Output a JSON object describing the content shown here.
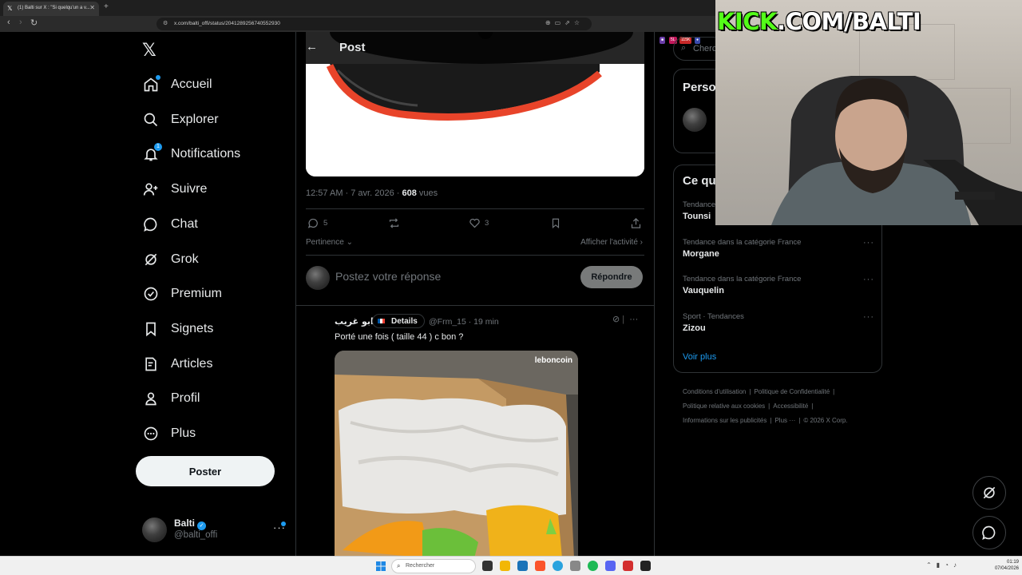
{
  "browser": {
    "tab_title": "(1) Balti sur X : \"Si quelqu'un a v...",
    "url": "x.com/balti_offi/status/2041289256740552930",
    "extensions": [
      "5L",
      "115K"
    ]
  },
  "nav": {
    "items": [
      {
        "label": "Accueil",
        "icon": "home-icon"
      },
      {
        "label": "Explorer",
        "icon": "search-icon"
      },
      {
        "label": "Notifications",
        "icon": "bell-icon",
        "badge": "1"
      },
      {
        "label": "Suivre",
        "icon": "add-person-icon"
      },
      {
        "label": "Chat",
        "icon": "chat-bubble-icon"
      },
      {
        "label": "Grok",
        "icon": "grok-icon"
      },
      {
        "label": "Premium",
        "icon": "verified-badge-icon"
      },
      {
        "label": "Signets",
        "icon": "bookmark-icon"
      },
      {
        "label": "Articles",
        "icon": "article-icon"
      },
      {
        "label": "Profil",
        "icon": "person-icon"
      },
      {
        "label": "Plus",
        "icon": "more-circle-icon"
      }
    ],
    "post_button": "Poster",
    "account": {
      "name": "Balti",
      "handle": "@balti_offi"
    }
  },
  "post": {
    "header_title": "Post",
    "time": "12:57 AM · 7 avr. 2026 · ",
    "views_count": "608",
    "views_label": " vues",
    "replies": "5",
    "likes": "3",
    "sort_label": "Pertinence",
    "activity_label": "Afficher l'activité",
    "reply_placeholder": "Postez votre réponse",
    "reply_button": "Répondre"
  },
  "reply": {
    "name": "ابو غريب",
    "badge": "Details",
    "handle_time": "@Frm_15 · 19 min",
    "text": "Porté une fois ( taille 44 ) c bon ?",
    "image_watermark": "leboncoin"
  },
  "sidebar": {
    "search_placeholder": "Cherc",
    "who_to_follow_title": "Perso",
    "trends_title": "Ce qu",
    "trends": [
      {
        "context": "Tendance",
        "name": "Tounsi"
      },
      {
        "context": "Tendance dans la catégorie France",
        "name": "Morgane"
      },
      {
        "context": "Tendance dans la catégorie France",
        "name": "Vauquelin"
      },
      {
        "context": "Sport · Tendances",
        "name": "Zizou"
      }
    ],
    "show_more": "Voir plus",
    "footer": [
      "Conditions d'utilisation",
      "Politique de Confidentialité",
      "Politique relative aux cookies",
      "Accessibilité",
      "Informations sur les publicités",
      "Plus ···",
      "© 2026 X Corp."
    ]
  },
  "overlay": {
    "kick_green": "KICK",
    "kick_white": ".COM/BALTI"
  },
  "taskbar": {
    "search_placeholder": "Rechercher",
    "time": "01:19",
    "date": "07/04/2026"
  },
  "colors": {
    "accent": "#1d9bf0",
    "kick_green": "#53fc18",
    "border": "#2f3336",
    "muted": "#71767b"
  }
}
